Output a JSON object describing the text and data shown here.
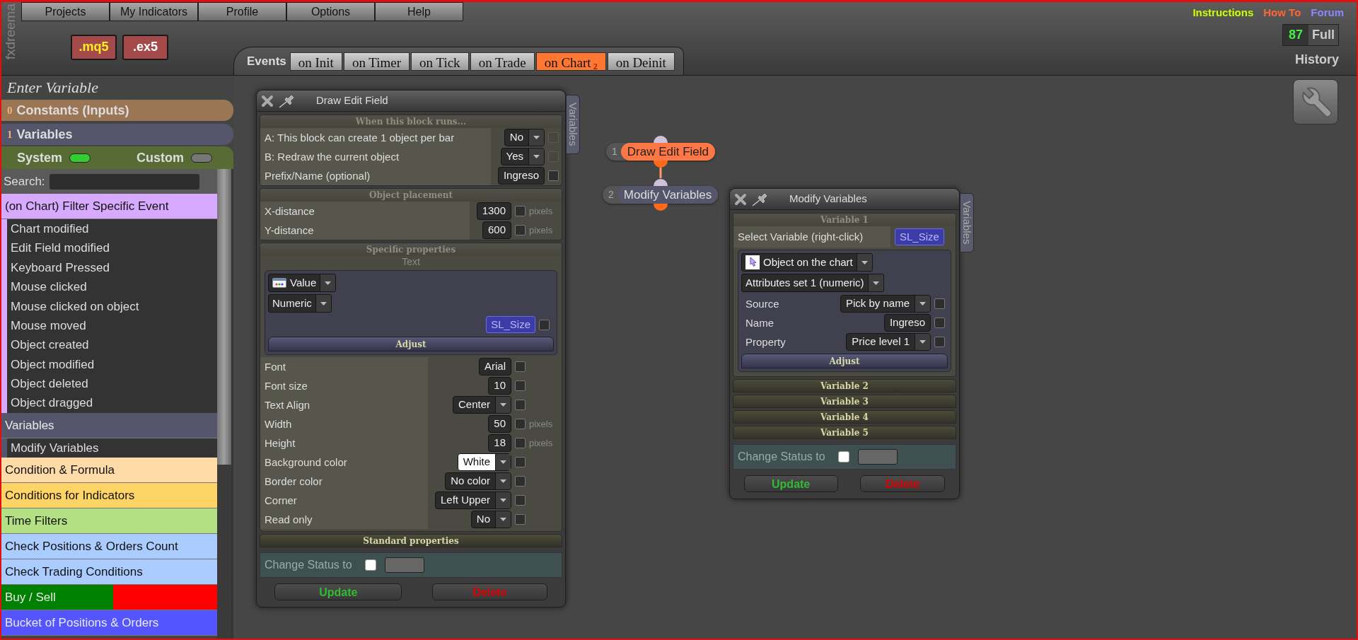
{
  "menu": [
    {
      "label": "Projects"
    },
    {
      "label": "My Indicators"
    },
    {
      "label": "Profile"
    },
    {
      "label": "Options"
    },
    {
      "label": "Help"
    }
  ],
  "brand": "fxdreema",
  "file_buttons": [
    {
      "label": ".mq5",
      "kind": "source"
    },
    {
      "label": ".ex5",
      "kind": "compiled"
    }
  ],
  "event_tabs": {
    "title": "Events",
    "tabs": [
      {
        "label": "on Init",
        "selected": false
      },
      {
        "label": "on Timer",
        "selected": false
      },
      {
        "label": "on Tick",
        "selected": false
      },
      {
        "label": "on Trade",
        "selected": false
      },
      {
        "label": "on Chart",
        "count": "2",
        "selected": true
      },
      {
        "label": "on Deinit",
        "selected": false
      }
    ]
  },
  "links": [
    {
      "label": "Instructions",
      "color": "#ccff00"
    },
    {
      "label": "How To",
      "color": "#ff6633"
    },
    {
      "label": "Forum",
      "color": "#8888ff"
    }
  ],
  "counter": {
    "value": "87",
    "label": "Full"
  },
  "history": "History",
  "sidebar": {
    "title": "Enter Variable",
    "sections": [
      {
        "index": "0",
        "label": "Constants (Inputs)",
        "color": "#9b7655"
      },
      {
        "index": "1",
        "label": "Variables",
        "color": "#55566b"
      }
    ],
    "toggles": [
      {
        "label": "System",
        "on": true
      },
      {
        "label": "Custom",
        "on": false
      }
    ],
    "search": {
      "label": "Search:"
    },
    "groups": [
      {
        "label": "(on Chart) Filter Specific Event",
        "color": "#d8aaff",
        "children": [
          {
            "label": "Chart modified"
          },
          {
            "label": "Edit Field modified"
          },
          {
            "label": "Keyboard Pressed"
          },
          {
            "label": "Mouse clicked"
          },
          {
            "label": "Mouse clicked on object"
          },
          {
            "label": "Mouse moved"
          },
          {
            "label": "Object created"
          },
          {
            "label": "Object modified"
          },
          {
            "label": "Object deleted"
          },
          {
            "label": "Object dragged"
          }
        ]
      },
      {
        "label": "Variables",
        "color": "#55566b",
        "children": [
          {
            "label": "Modify Variables"
          }
        ]
      },
      {
        "label": "Condition & Formula",
        "color": "#ffdba8"
      },
      {
        "label": "Conditions for Indicators",
        "color": "#ffd466"
      },
      {
        "label": "Time Filters",
        "color": "#b2e082"
      },
      {
        "label": "Check Positions & Orders Count",
        "color": "#aaccff"
      },
      {
        "label": "Check Trading Conditions",
        "color": "#aaccff"
      },
      {
        "label": "Buy / Sell",
        "segments": [
          {
            "color": "#008000"
          },
          {
            "color": "#ff0000"
          }
        ]
      },
      {
        "label": "Bucket of Positions & Orders",
        "color": "#5555ff"
      }
    ]
  },
  "canvas": {
    "nodes": [
      {
        "number": "1",
        "label": "Draw Edit Field",
        "color": "#ff7744"
      },
      {
        "number": "2",
        "label": "Modify Variables",
        "color": "#55566b"
      }
    ],
    "panels": [
      {
        "title": "Draw Edit Field",
        "side_tab": "Variables",
        "sections": [
          {
            "kind": "form",
            "title": "When this block runs...",
            "rows": [
              {
                "label": "A: This block can create 1 object per bar",
                "kind": "select",
                "value": "No",
                "checked": false,
                "disabled": true
              },
              {
                "label": "B: Redraw the current object",
                "kind": "select",
                "value": "Yes",
                "checked": false,
                "disabled": true
              },
              {
                "label": "Prefix/Name (optional)",
                "kind": "input",
                "value": "Ingreso",
                "checked": false,
                "disabled": false
              }
            ]
          },
          {
            "kind": "form",
            "title": "Object placement",
            "rows": [
              {
                "label": "X-distance",
                "kind": "input",
                "value": "1300",
                "unit": "pixels",
                "checked": false
              },
              {
                "label": "Y-distance",
                "kind": "input",
                "value": "600",
                "unit": "pixels",
                "checked": false
              }
            ]
          },
          {
            "kind": "group",
            "title": "Specific properties",
            "subtitle": "Text",
            "box": {
              "selects": [
                {
                  "kind": "value",
                  "value": "Value"
                },
                {
                  "kind": "plain",
                  "value": "Numeric"
                }
              ],
              "variable": {
                "value": "SL_Size",
                "checked": false
              },
              "button": "Adjust"
            },
            "rows": [
              {
                "label": "Font",
                "kind": "input",
                "value": "Arial",
                "checked": false
              },
              {
                "label": "Font size",
                "kind": "input",
                "value": "10",
                "checked": false
              },
              {
                "label": "Text Align",
                "kind": "select",
                "value": "Center",
                "checked": false
              },
              {
                "label": "Width",
                "kind": "input",
                "value": "50",
                "unit": "pixels",
                "checked": false
              },
              {
                "label": "Height",
                "kind": "input",
                "value": "18",
                "unit": "pixels",
                "checked": false
              },
              {
                "label": "Background color",
                "kind": "select",
                "value": "White",
                "color": "#ffffff",
                "checked": false
              },
              {
                "label": "Border color",
                "kind": "select",
                "value": "No color",
                "checked": false
              },
              {
                "label": "Corner",
                "kind": "select",
                "value": "Left Upper",
                "checked": false
              },
              {
                "label": "Read only",
                "kind": "select",
                "value": "No",
                "checked": false
              }
            ]
          },
          {
            "kind": "collapsed",
            "title": "Standard properties"
          }
        ],
        "status": {
          "label": "Change Status to",
          "checked": false
        },
        "buttons": [
          {
            "label": "Update",
            "kind": "update"
          },
          {
            "label": "Delete",
            "kind": "delete"
          }
        ]
      },
      {
        "title": "Modify Variables",
        "side_tab": "Variables",
        "sections": [
          {
            "kind": "group",
            "title": "Variable 1",
            "label": "Select Variable (right-click)",
            "variable": {
              "value": "SL_Size"
            },
            "box": {
              "selects": [
                {
                  "kind": "object",
                  "value": "Object on the chart"
                },
                {
                  "kind": "plain",
                  "value": "Attributes set 1 (numeric)"
                }
              ],
              "rows": [
                {
                  "label": "Source",
                  "kind": "select",
                  "value": "Pick by name",
                  "checked": false
                },
                {
                  "label": "Name",
                  "kind": "input",
                  "value": "Ingreso",
                  "checked": false
                },
                {
                  "label": "Property",
                  "kind": "select",
                  "value": "Price level 1",
                  "checked": false
                }
              ],
              "button": "Adjust"
            }
          },
          {
            "kind": "collapsed",
            "title": "Variable 2"
          },
          {
            "kind": "collapsed",
            "title": "Variable 3"
          },
          {
            "kind": "collapsed",
            "title": "Variable 4"
          },
          {
            "kind": "collapsed",
            "title": "Variable 5"
          }
        ],
        "status": {
          "label": "Change Status to",
          "checked": false
        },
        "buttons": [
          {
            "label": "Update",
            "kind": "update"
          },
          {
            "label": "Delete",
            "kind": "delete"
          }
        ]
      }
    ]
  }
}
